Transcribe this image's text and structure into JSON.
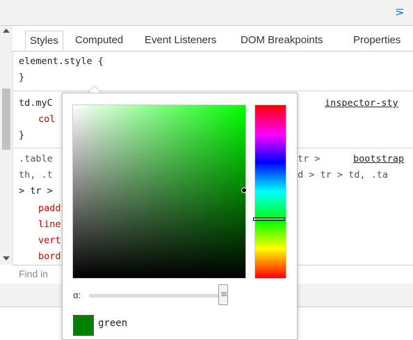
{
  "toolbar": {
    "dock_icon": "sidebar-toggle-icon"
  },
  "tabs": [
    "Styles",
    "Computed",
    "Event Listeners",
    "DOM Breakpoints",
    "Properties"
  ],
  "rules": {
    "element_style": {
      "selector": "element.style {",
      "close": "}"
    },
    "rule2": {
      "selector": "td.myC",
      "prop": "col",
      "close": "}",
      "source": "inspector-sty"
    },
    "rule3": {
      "sel_line1": ".table",
      "sel_line1_right": "tr >",
      "sel_line2": "th, .t",
      "sel_line2_right": "d > tr > td, .ta",
      "sel_line3": "> tr >",
      "props": [
        "padd",
        "line",
        "vert",
        "bord"
      ],
      "source": "bootstrap"
    }
  },
  "find": {
    "placeholder": "Find in"
  },
  "picker": {
    "hue_color": "#00ff00",
    "alpha_label": "α:",
    "alpha_value": 1.0,
    "swatch_color": "#008000",
    "swatch_name": "green"
  }
}
